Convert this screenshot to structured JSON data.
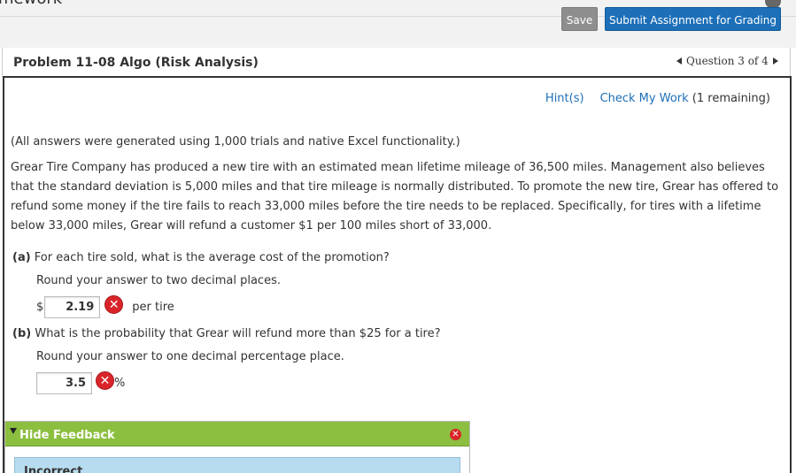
{
  "app": {
    "title": "mework"
  },
  "toolbar": {
    "save_label": "Save",
    "submit_label": "Submit Assignment for Grading"
  },
  "problem": {
    "title": "Problem 11-08 Algo (Risk Analysis)",
    "nav": {
      "text": "Question 3 of 4"
    }
  },
  "tools": {
    "hint_label": "Hint(s)",
    "check_label": "Check My Work",
    "remaining": "(1 remaining)"
  },
  "content": {
    "intro": "(All answers were generated using 1,000 trials and native Excel functionality.)",
    "body": "Grear Tire Company has produced a new tire with an estimated mean lifetime mileage of 36,500 miles. Management also believes that the standard deviation is 5,000 miles and that tire mileage is normally distributed. To promote the new tire, Grear has offered to refund some money if the tire fails to reach 33,000 miles before the tire needs to be replaced. Specifically, for tires with a lifetime below 33,000 miles, Grear will refund a customer $1 per 100 miles short of 33,000."
  },
  "qa": {
    "a_label": "(a)",
    "a_question": "For each tire sold, what is the average cost of the promotion?",
    "a_round": "Round your answer to two decimal places.",
    "a_prefix": "$",
    "a_value": "2.19",
    "a_suffix": "per tire",
    "b_label": "(b)",
    "b_question": "What is the probability that Grear will refund more than $25 for a tire?",
    "b_round": "Round your answer to one decimal percentage place.",
    "b_value": "3.5",
    "b_suffix": "%"
  },
  "feedback": {
    "header_label": "Hide Feedback",
    "status_label": "Incorrect"
  },
  "icons": {
    "wrong": "x-circle-icon",
    "close": "close-icon"
  },
  "colors": {
    "submit": "#1d6fb8",
    "feedback_header": "#8cbf40",
    "feedback_body": "#b8dcef",
    "wrong": "#d9252a"
  }
}
